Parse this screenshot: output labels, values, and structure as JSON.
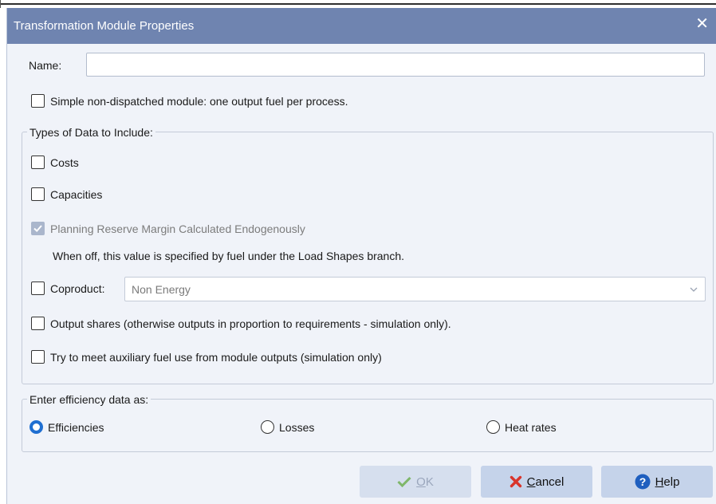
{
  "dialog": {
    "title": "Transformation Module Properties",
    "close_glyph": "✕"
  },
  "name_field": {
    "label": "Name:",
    "value": ""
  },
  "simple_module": {
    "label": "Simple non-dispatched module: one output fuel per process.",
    "checked": false
  },
  "types_group": {
    "title": "Types of Data to Include:",
    "costs": {
      "label": "Costs",
      "checked": false
    },
    "capacities": {
      "label": "Capacities",
      "checked": false
    },
    "planning_reserve": {
      "label": "Planning Reserve Margin Calculated Endogenously",
      "checked": true,
      "disabled": true
    },
    "planning_note": "When off, this value is specified by fuel under the Load Shapes branch.",
    "coproduct": {
      "label": "Coproduct:",
      "checked": false,
      "selected_value": "Non Energy"
    },
    "output_shares": {
      "label": "Output shares (otherwise outputs in proportion to requirements - simulation only).",
      "checked": false
    },
    "auxiliary": {
      "label": "Try to meet auxiliary fuel use from module outputs (simulation only)",
      "checked": false
    }
  },
  "efficiency_group": {
    "title": "Enter efficiency data as:",
    "options": [
      {
        "label": "Efficiencies",
        "selected": true
      },
      {
        "label": "Losses",
        "selected": false
      },
      {
        "label": "Heat rates",
        "selected": false
      }
    ]
  },
  "buttons": {
    "ok": {
      "label_first": "O",
      "label_rest": "K",
      "enabled": false,
      "icon": "checkmark-icon"
    },
    "cancel": {
      "label_first": "C",
      "label_rest": "ancel",
      "icon": "red-x-icon"
    },
    "help": {
      "label_first": "H",
      "label_rest": "elp",
      "icon": "question-icon"
    }
  },
  "colors": {
    "titlebar": "#6f84b0",
    "background": "#f0f3f9",
    "button": "#c5d3ea",
    "radio_accent": "#1f6fd1",
    "cancel_icon": "#d9342b",
    "help_icon": "#1f5fbf",
    "ok_icon": "#7fb76a"
  }
}
